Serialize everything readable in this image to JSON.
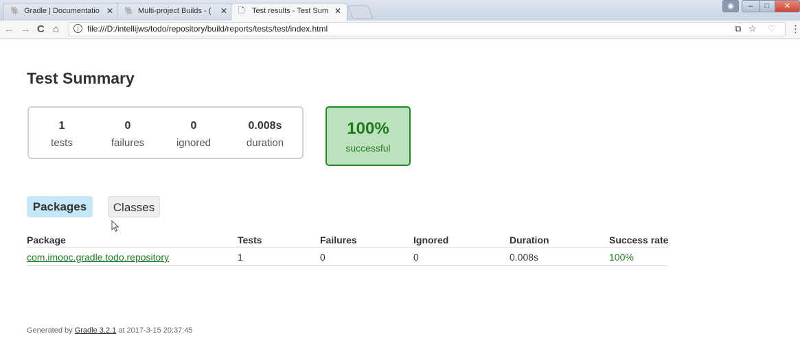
{
  "browser": {
    "tabs": [
      {
        "label": "Gradle | Documentatio",
        "icon": "gradle-elephant-icon"
      },
      {
        "label": "Multi-project Builds - (",
        "icon": "gradle-elephant-icon"
      },
      {
        "label": "Test results - Test Sum",
        "icon": "page-icon"
      }
    ],
    "tab_close": "✕",
    "url": "file:///D:/intellijws/todo/repository/build/reports/tests/test/index.html",
    "info_glyph": "i",
    "nav": {
      "back": "←",
      "forward": "→",
      "reload": "C",
      "home": "⌂"
    },
    "right_icons": {
      "translate": "⧉",
      "star": "☆",
      "shield": "♡",
      "menu": "⋮"
    },
    "window_controls": {
      "user": "◉",
      "minimize": "–",
      "maximize": "□",
      "close": "✕"
    }
  },
  "page": {
    "title": "Test Summary",
    "counters": [
      {
        "value": "1",
        "label": "tests"
      },
      {
        "value": "0",
        "label": "failures"
      },
      {
        "value": "0",
        "label": "ignored"
      },
      {
        "value": "0.008s",
        "label": "duration"
      }
    ],
    "success": {
      "percent": "100%",
      "label": "successful"
    },
    "tabs": {
      "packages": "Packages",
      "classes": "Classes"
    },
    "table": {
      "headers": [
        "Package",
        "Tests",
        "Failures",
        "Ignored",
        "Duration",
        "Success rate"
      ],
      "rows": [
        [
          "com.imooc.gradle.todo.repository",
          "1",
          "0",
          "0",
          "0.008s",
          "100%"
        ]
      ]
    },
    "footer": {
      "prefix": "Generated by ",
      "link": "Gradle 3.2.1",
      "suffix": " at 2017-3-15 20:37:45"
    }
  },
  "colors": {
    "success_green": "#1b7a1b",
    "success_bg": "#bde0bd",
    "selected_tab_bg": "#c5e8f7"
  }
}
